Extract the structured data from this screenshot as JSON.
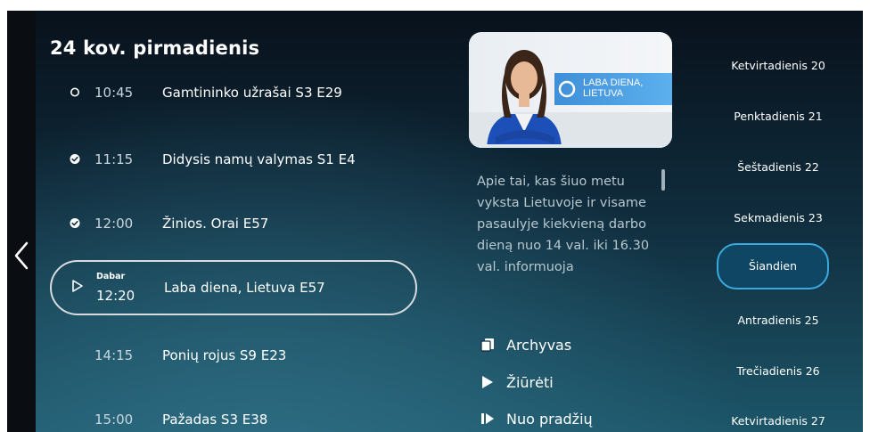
{
  "schedule": {
    "day_title": "24 kov. pirmadienis",
    "items": [
      {
        "time": "10:45",
        "title": "Gamtininko užrašai S3 E29",
        "status": "upcoming-circle"
      },
      {
        "time": "11:15",
        "title": "Didysis namų valymas S1 E4",
        "status": "check"
      },
      {
        "time": "12:00",
        "title": "Žinios. Orai E57",
        "status": "check"
      },
      {
        "time": "12:20",
        "title": "Laba diena, Lietuva E57",
        "status": "play",
        "now_label": "Dabar"
      },
      {
        "time": "14:15",
        "title": "Ponių rojus S9 E23",
        "status": "none"
      },
      {
        "time": "15:00",
        "title": "Pažadas S3 E38",
        "status": "none"
      }
    ]
  },
  "detail": {
    "thumbnail_caption": "LABA DIENA, LIETUVA",
    "description": "Apie tai, kas šiuo metu vyksta Lietuvoje ir visame pasaulyje kiekvieną darbo dieną nuo 14 val. iki 16.30 val. informuoja",
    "actions": [
      {
        "label": "Archyvas",
        "icon": "archive-icon"
      },
      {
        "label": "Žiūrėti",
        "icon": "play-icon"
      },
      {
        "label": "Nuo pradžių",
        "icon": "restart-icon"
      }
    ]
  },
  "dates": [
    {
      "label": "Ketvirtadienis 20"
    },
    {
      "label": "Penktadienis 21"
    },
    {
      "label": "Šeštadienis 22"
    },
    {
      "label": "Sekmadienis 23"
    },
    {
      "label": "Šiandien",
      "selected": true
    },
    {
      "label": "Antradienis 25"
    },
    {
      "label": "Trečiadienis 26"
    },
    {
      "label": "Ketvirtadienis 27"
    }
  ],
  "colors": {
    "accent": "#39a9e0",
    "background_top": "#08111b",
    "background_bottom": "#1c5568",
    "text_primary": "#ffffff",
    "text_secondary": "#b7c7cf"
  }
}
